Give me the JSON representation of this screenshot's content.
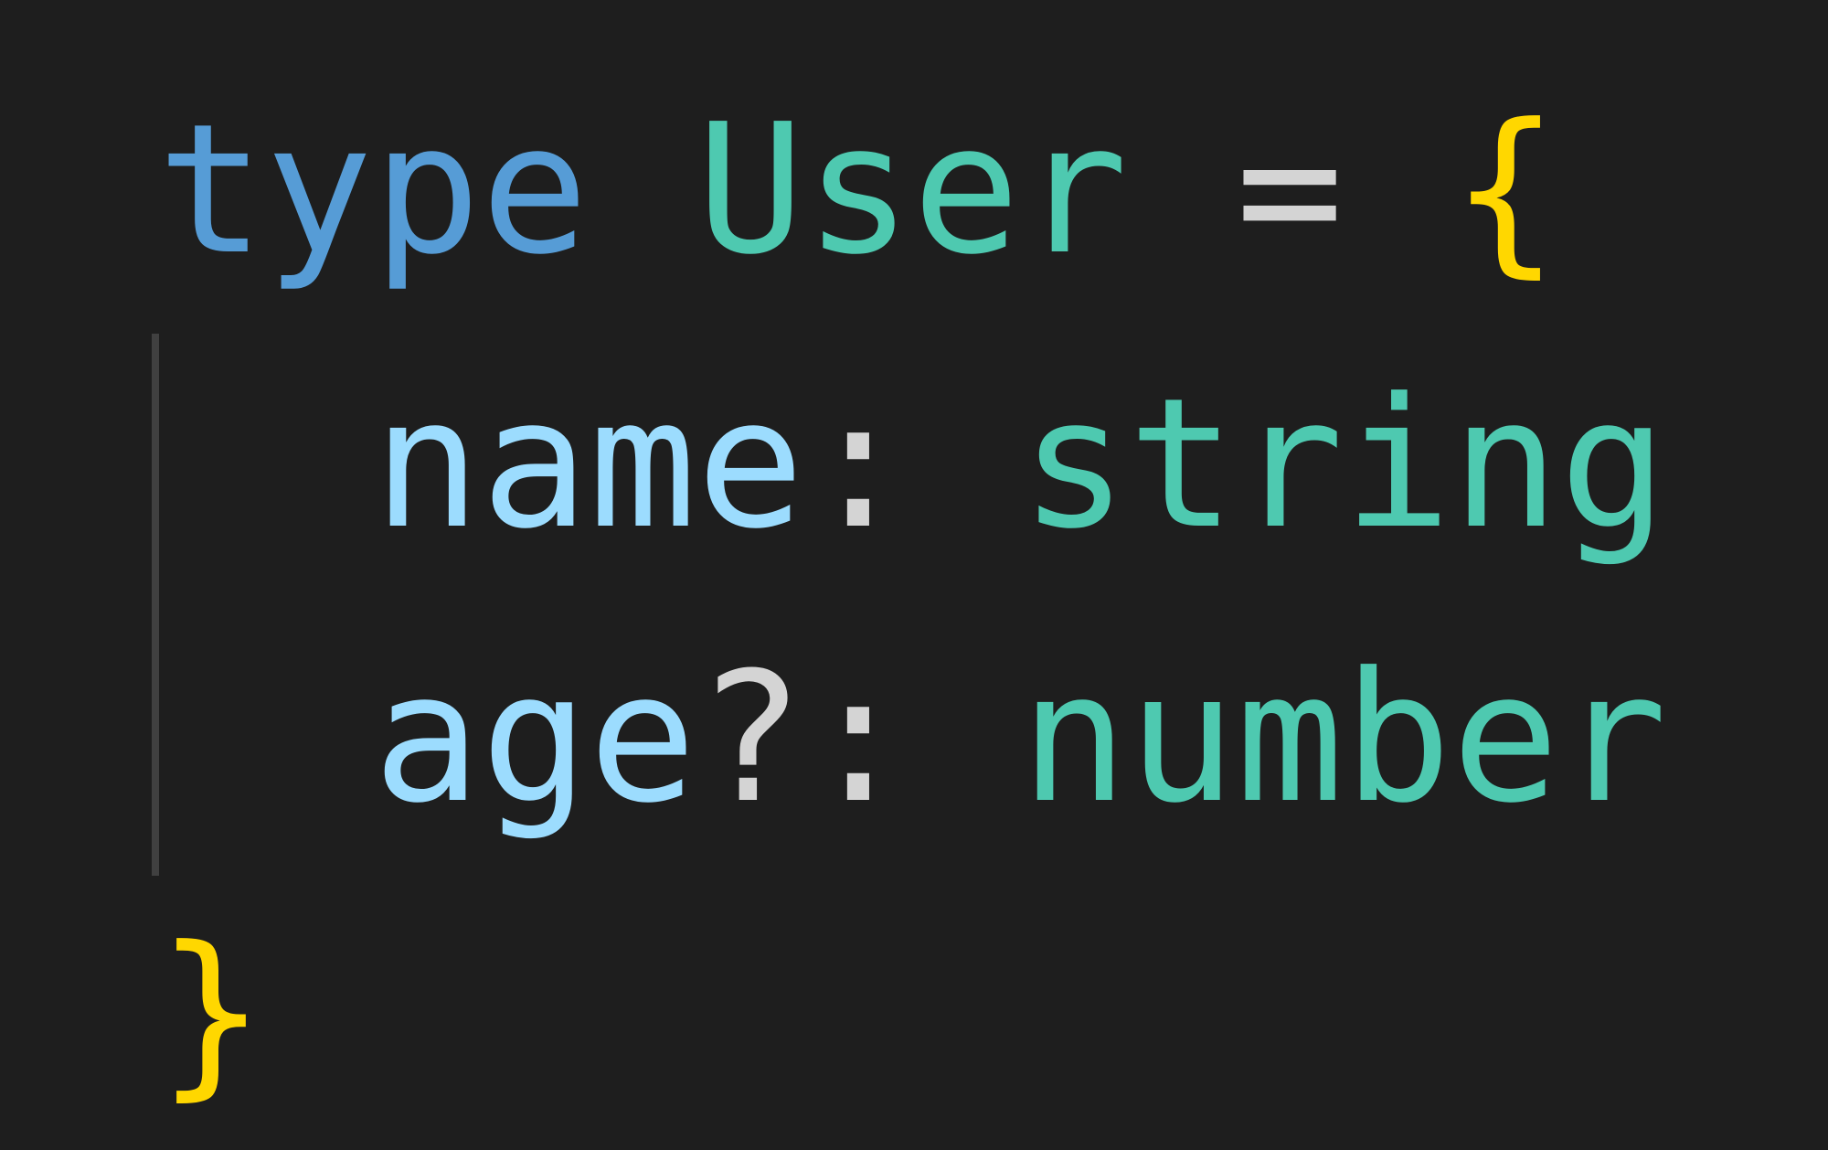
{
  "editor": {
    "lines": [
      {
        "keyword": "type",
        "name": "User",
        "op": "=",
        "brace": "{"
      },
      {
        "indent": "  ",
        "prop": "name",
        "colon": ":",
        "type": "string"
      },
      {
        "indent": "  ",
        "prop": "age",
        "optional": "?",
        "colon": ":",
        "type": "number"
      },
      {
        "brace": "}"
      }
    ],
    "colors": {
      "background": "#1e1e1e",
      "keyword": "#569cd6",
      "type": "#4ec9b0",
      "property": "#9cdcfe",
      "punctuation": "#d4d4d4",
      "brace": "#ffd700"
    }
  }
}
